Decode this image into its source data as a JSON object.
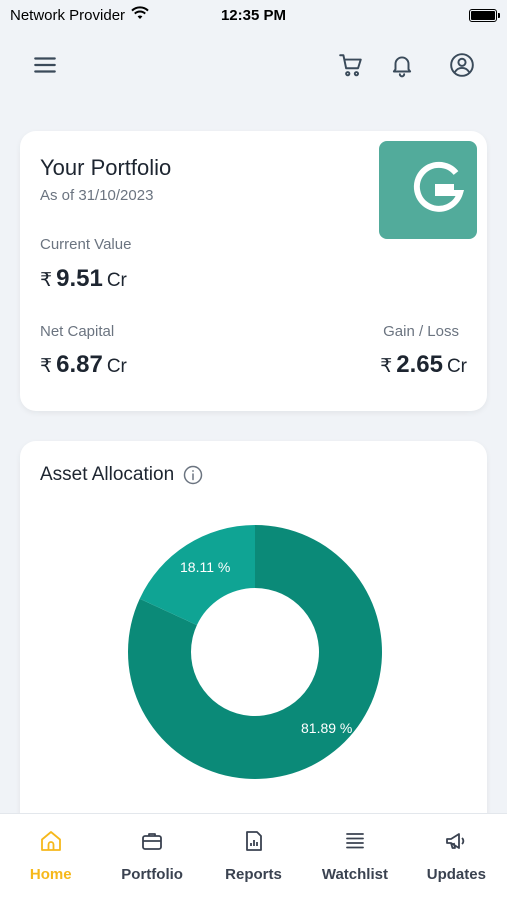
{
  "status_bar": {
    "carrier": "Network Provider",
    "time": "12:35 PM"
  },
  "portfolio": {
    "title": "Your Portfolio",
    "as_of": "As of 31/10/2023",
    "current_value_label": "Current Value",
    "current_value": {
      "currency": "₹",
      "amount": "9.51",
      "unit": "Cr"
    },
    "net_capital_label": "Net Capital",
    "net_capital": {
      "currency": "₹",
      "amount": "6.87",
      "unit": "Cr"
    },
    "gain_loss_label": "Gain / Loss",
    "gain_loss": {
      "currency": "₹",
      "amount": "2.65",
      "unit": "Cr"
    }
  },
  "allocation": {
    "title": "Asset Allocation",
    "slices": [
      {
        "label": "81.89 %",
        "percent": 81.89,
        "color": "#0b8a78"
      },
      {
        "label": "18.11 %",
        "percent": 18.11,
        "color": "#0fa494"
      }
    ]
  },
  "tabs": [
    {
      "label": "Home",
      "icon": "home-icon",
      "active": true
    },
    {
      "label": "Portfolio",
      "icon": "briefcase-icon",
      "active": false
    },
    {
      "label": "Reports",
      "icon": "report-icon",
      "active": false
    },
    {
      "label": "Watchlist",
      "icon": "list-icon",
      "active": false
    },
    {
      "label": "Updates",
      "icon": "megaphone-icon",
      "active": false
    }
  ],
  "colors": {
    "accent": "#f6b81b",
    "brand_tile": "#52ab9b",
    "donut_main": "#0b8a78",
    "donut_minor": "#0fa494"
  }
}
